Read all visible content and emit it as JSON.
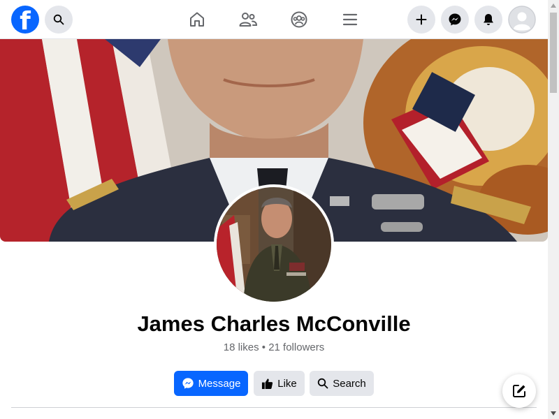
{
  "brand": {
    "logo_letter": "f",
    "color": "#0866ff"
  },
  "topbar": {
    "search_icon": "search-icon",
    "nav": [
      "home-icon",
      "friends-icon",
      "groups-icon",
      "menu-icon"
    ],
    "actions": [
      "plus-icon",
      "messenger-icon",
      "bell-icon",
      "account-avatar"
    ]
  },
  "profile": {
    "name": "James Charles McConville",
    "stats": "18 likes • 21 followers"
  },
  "buttons": {
    "message": "Message",
    "like": "Like",
    "search": "Search"
  },
  "colors": {
    "primary": "#0866ff",
    "secondary_bg": "#e4e6eb",
    "text": "#050505",
    "muted": "#65676b"
  }
}
